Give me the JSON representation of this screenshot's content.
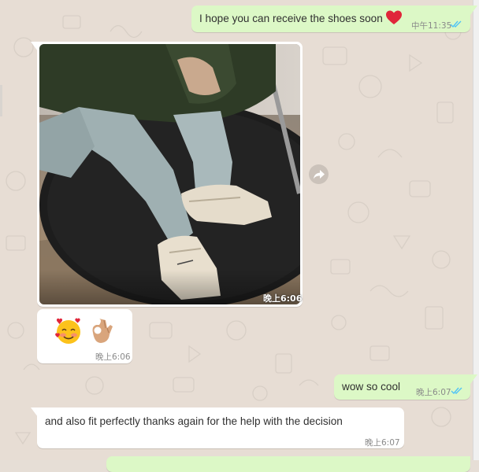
{
  "messages": [
    {
      "id": "m1",
      "direction": "outgoing",
      "text": "I hope you can receive the shoes soon",
      "emoji": "red-heart",
      "time": "中午11:35",
      "status": "read"
    },
    {
      "id": "m2",
      "direction": "incoming",
      "type": "image",
      "image": "photo of person wearing cream sneakers on a black round rug",
      "time": "晚上6:06"
    },
    {
      "id": "m3",
      "direction": "incoming",
      "type": "emoji",
      "emoji": [
        "smiling-face-with-hearts",
        "ok-hand"
      ],
      "time": "晚上6:06"
    },
    {
      "id": "m4",
      "direction": "outgoing",
      "text": "wow so cool",
      "time": "晚上6:07",
      "status": "read"
    },
    {
      "id": "m5",
      "direction": "incoming",
      "text": "and also fit perfectly thanks again for the help with the decision",
      "time": "晚上6:07"
    }
  ],
  "icons": {
    "forward": "forward-arrow-icon",
    "read_receipt": "double-check-icon"
  },
  "colors": {
    "outgoing_bubble": "#dcf8c6",
    "incoming_bubble": "#ffffff",
    "chat_background": "#e7ddd4",
    "read_tick": "#4fc3f7"
  }
}
